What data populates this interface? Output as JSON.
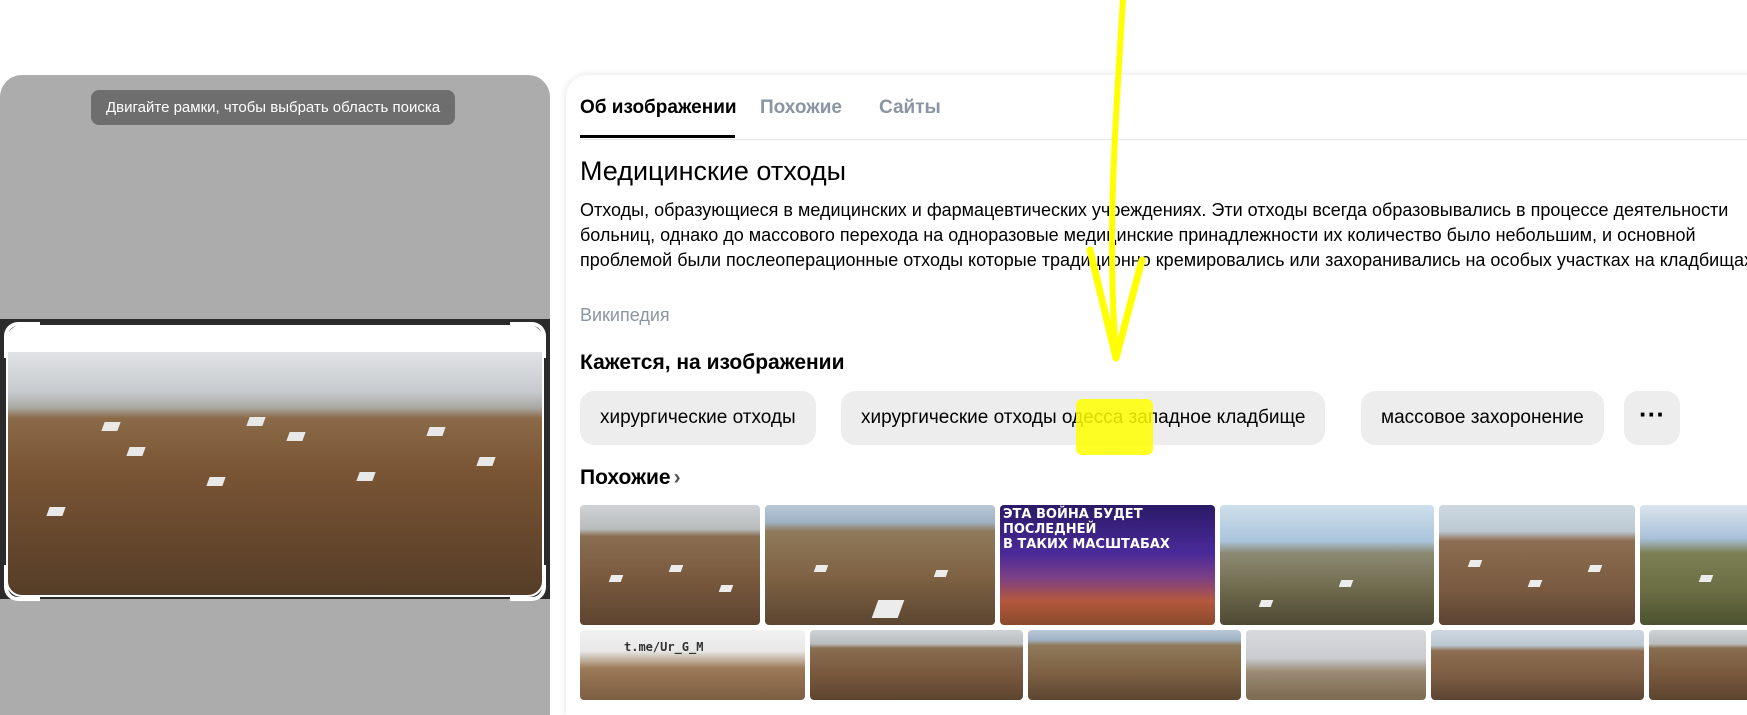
{
  "left_panel": {
    "hint": "Двигайте рамки, чтобы выбрать область поиска"
  },
  "tabs": [
    {
      "label": "Об изображении",
      "active": true
    },
    {
      "label": "Похожие",
      "active": false
    },
    {
      "label": "Сайты",
      "active": false
    }
  ],
  "entity": {
    "title": "Медицинские отходы",
    "description": "Отходы, образующиеся в медицинских и фармацевтических учреждениях. Эти отходы всегда образовывались в процессе деятельности больниц, однако до массового перехода на одноразовые медицинские принадлежности их количество было небольшим, и основной проблемой были послеоперационные отходы которые традиционно кремировались или захоранивались на особых участках на кладбищах.",
    "source": "Википедия"
  },
  "tags_section": {
    "title": "Кажется, на изображении",
    "chips": [
      "хирургические отходы",
      "хирургические отходы одесса западное кладбище",
      "массовое захоронение"
    ],
    "more_icon": "more-dots-icon"
  },
  "similar": {
    "title": "Похожие",
    "chevron_icon": "chevron-right-icon",
    "war_caption": "ЭТА ВОЙНА БУДЕТ\nПОСЛЕДНЕЙ\nВ ТАКИХ МАСШТАБАХ",
    "watermark": "t.me/Ur_G_M"
  },
  "annotation": {
    "color": "#ffff00",
    "shapes": [
      "arrow-down",
      "highlight"
    ]
  }
}
